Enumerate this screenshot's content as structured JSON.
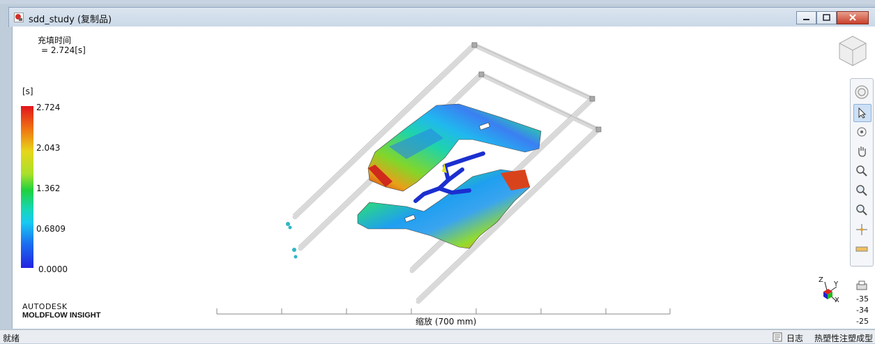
{
  "window": {
    "title": "sdd_study (复制品)",
    "icon": "moldflow-study-icon"
  },
  "result": {
    "title": "充填时间",
    "value_line": "= 2.724[s]"
  },
  "legend": {
    "unit": "[s]",
    "ticks": [
      "2.724",
      "2.043",
      "1.362",
      "0.6809",
      "0.0000"
    ]
  },
  "branding": {
    "line1": "AUTODESK",
    "line2": "MOLDFLOW",
    "line2b": "INSIGHT"
  },
  "scale": {
    "label": "缩放 (700 mm)"
  },
  "toolbar": {
    "tools": [
      "orbit-icon",
      "select-icon",
      "rotate-icon",
      "pan-icon",
      "zoom-icon",
      "zoom-in-icon",
      "zoom-out-icon",
      "center-icon",
      "measure-icon",
      "print-icon"
    ]
  },
  "axes": {
    "labels": [
      "Z",
      "Y",
      "X"
    ],
    "readout": [
      "-35",
      "-34",
      "-25"
    ]
  },
  "statusbar": {
    "left": "就绪",
    "log": "日志",
    "process": "热塑性注塑成型"
  },
  "colors": {
    "legend_top": "#e2141b",
    "legend_bottom": "#2222e0",
    "runner": "#1b2fd0"
  }
}
